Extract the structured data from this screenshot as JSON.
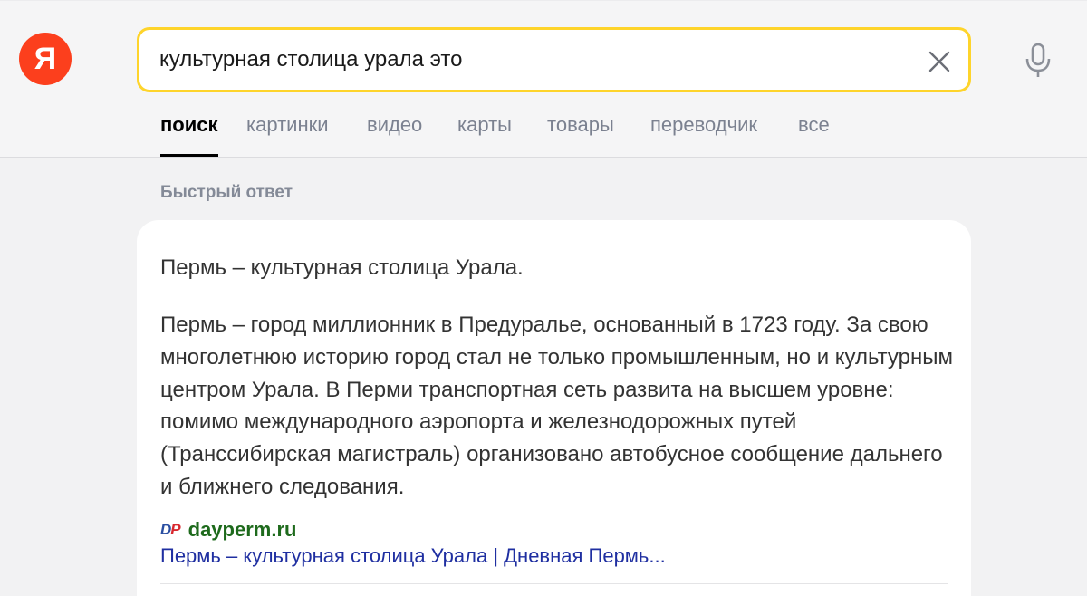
{
  "logo": {
    "letter": "Я"
  },
  "search": {
    "query": "культурная столица урала это"
  },
  "tabs": [
    {
      "label": "поиск"
    },
    {
      "label": "картинки"
    },
    {
      "label": "видео"
    },
    {
      "label": "карты"
    },
    {
      "label": "товары"
    },
    {
      "label": "переводчик"
    },
    {
      "label": "все"
    }
  ],
  "answer": {
    "label": "Быстрый ответ",
    "title": "Пермь – культурная столица Урала.",
    "body": "Пермь – город миллионник в Предуралье, основанный в 1723 году. За свою многолетнюю историю город стал не только промышленным, но и культурным центром Урала. В Перми транспортная сеть развита на высшем уровне: помимо международного аэропорта и железнодорожных путей (Транссибирская магистраль) организовано автобусное сообщение дальнего и ближнего следования.",
    "source": {
      "favicon_d": "D",
      "favicon_p": "P",
      "domain": "dayperm.ru",
      "link_text": "Пермь – культурная столица Урала | Дневная Пермь..."
    }
  },
  "colors": {
    "logo_bg": "#fc3f1d",
    "search_border": "#fed42b",
    "link": "#1f2fa1",
    "domain": "#1e6a1c"
  },
  "icons": [
    "close-icon",
    "microphone-icon"
  ]
}
